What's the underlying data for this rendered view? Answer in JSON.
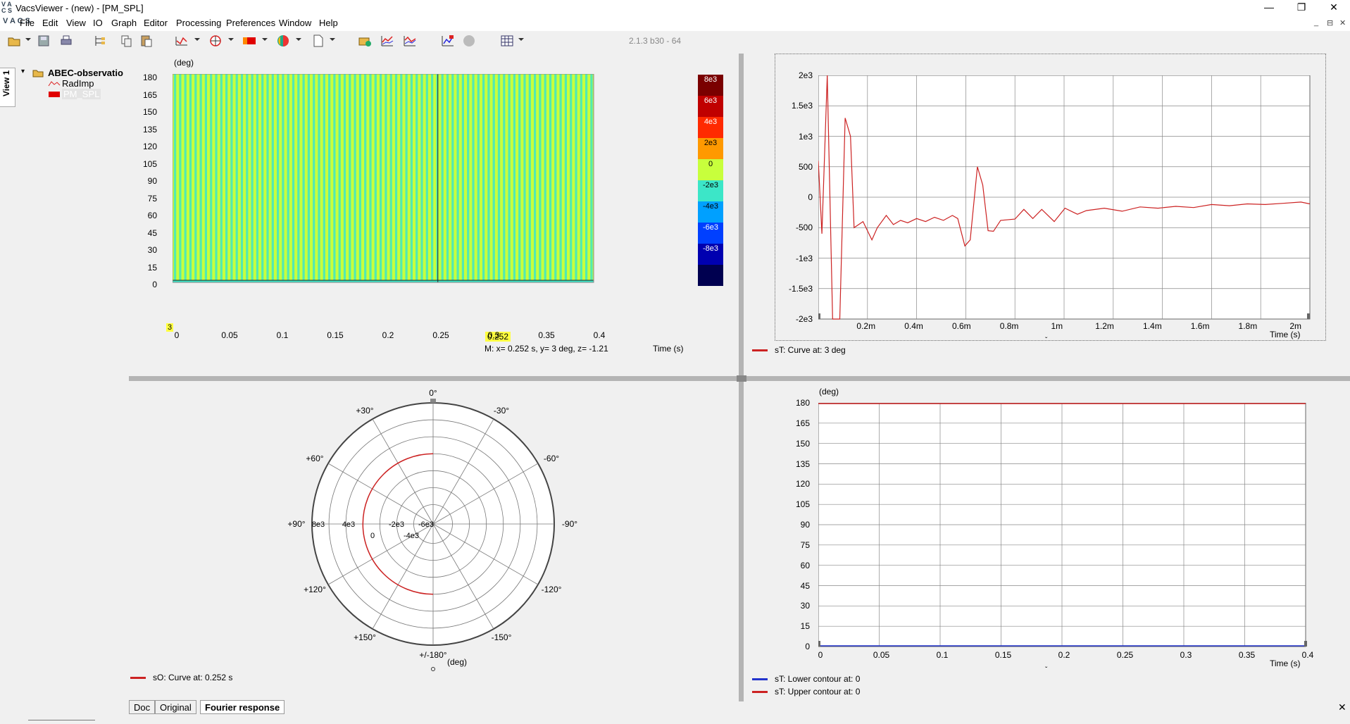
{
  "window": {
    "title": "VacsViewer - (new) - [PM_SPL]",
    "logo": "V A C S",
    "controls": [
      "—",
      "❐",
      "✕"
    ],
    "mdi_controls": [
      "_",
      "⊟",
      "✕"
    ]
  },
  "menu": [
    "File",
    "Edit",
    "View",
    "IO",
    "Graph",
    "Editor",
    "Processing",
    "Preferences",
    "Window",
    "Help"
  ],
  "toolbar": {
    "version": "2.1.3 b30 - 64",
    "icons": [
      "open-icon",
      "save-icon",
      "print-icon",
      "tree-icon",
      "copy-icon",
      "paste-icon",
      "curve-icon",
      "polar-icon",
      "map-icon",
      "sphere-icon",
      "page-icon",
      "import-icon",
      "graph-a-icon",
      "graph-b-icon",
      "graph-c-icon",
      "stop-icon",
      "grid-icon"
    ]
  },
  "sidebar": {
    "view_tab": "View 1",
    "tree": {
      "root": "ABEC-observatio",
      "children": [
        "RadImp",
        "PM_SPL"
      ],
      "selected": "PM_SPL"
    }
  },
  "contour": {
    "y_unit": "(deg)",
    "y_ticks": [
      "180",
      "165",
      "150",
      "135",
      "120",
      "105",
      "90",
      "75",
      "60",
      "45",
      "30",
      "15",
      "0"
    ],
    "x_ticks": [
      "0",
      "0.05",
      "0.1",
      "0.15",
      "0.2",
      "0.25",
      "0.3",
      "0.35",
      "0.4"
    ],
    "x_label": "Time  (s)",
    "cursor_value": "0.252",
    "cursor_y_marker": "3",
    "readout": "M:  x= 0.252 s,  y= 3 deg, z= -1.21",
    "colorbar": [
      {
        "label": "8e3",
        "color": "#7a0000"
      },
      {
        "label": "6e3",
        "color": "#c00000"
      },
      {
        "label": "4e3",
        "color": "#ff2a00"
      },
      {
        "label": "2e3",
        "color": "#ff9900"
      },
      {
        "label": "0",
        "color": "#c8ff3c"
      },
      {
        "label": "-2e3",
        "color": "#3ce6c8"
      },
      {
        "label": "-4e3",
        "color": "#00a0ff"
      },
      {
        "label": "-6e3",
        "color": "#0040ff"
      },
      {
        "label": "-8e3",
        "color": "#0000b0"
      },
      {
        "label": "",
        "color": "#000050"
      }
    ]
  },
  "time_curve": {
    "y_ticks": [
      "2e3",
      "1.5e3",
      "1e3",
      "500",
      "0",
      "-500",
      "-1e3",
      "-1.5e3",
      "-2e3"
    ],
    "x_ticks": [
      "0.2m",
      "0.4m",
      "0.6m",
      "0.8m",
      "1m",
      "1.2m",
      "1.4m",
      "1.6m",
      "1.8m",
      "2m"
    ],
    "x_label": "Time  (s)",
    "legend": "sT: Curve at: 3 deg",
    "line_color": "#cc2222"
  },
  "polar": {
    "angle_labels": [
      "0°",
      "-30°",
      "-60°",
      "-90°",
      "-120°",
      "-150°",
      "+/-180°",
      "+150°",
      "+120°",
      "+90°",
      "+60°",
      "+30°"
    ],
    "radial_labels": [
      "8e3",
      "4e3",
      "0",
      "-2e3",
      "-6e3",
      "-4e3"
    ],
    "unit": "(deg)",
    "legend": "sO: Curve at: 0.252 s",
    "line_color": "#cc2222"
  },
  "contour_limits": {
    "y_unit": "(deg)",
    "y_ticks": [
      "180",
      "165",
      "150",
      "135",
      "120",
      "105",
      "90",
      "75",
      "60",
      "45",
      "30",
      "15",
      "0"
    ],
    "x_ticks": [
      "0",
      "0.05",
      "0.1",
      "0.15",
      "0.2",
      "0.25",
      "0.3",
      "0.35",
      "0.4"
    ],
    "x_label": "Time  (s)",
    "legend_lower": "sT: Lower contour at: 0",
    "legend_upper": "sT: Upper contour at: 0",
    "lower_color": "#2233cc",
    "upper_color": "#cc2222"
  },
  "bottom_tabs": [
    "Doc",
    "Original",
    "Fourier response"
  ],
  "active_tab": "Fourier response"
}
